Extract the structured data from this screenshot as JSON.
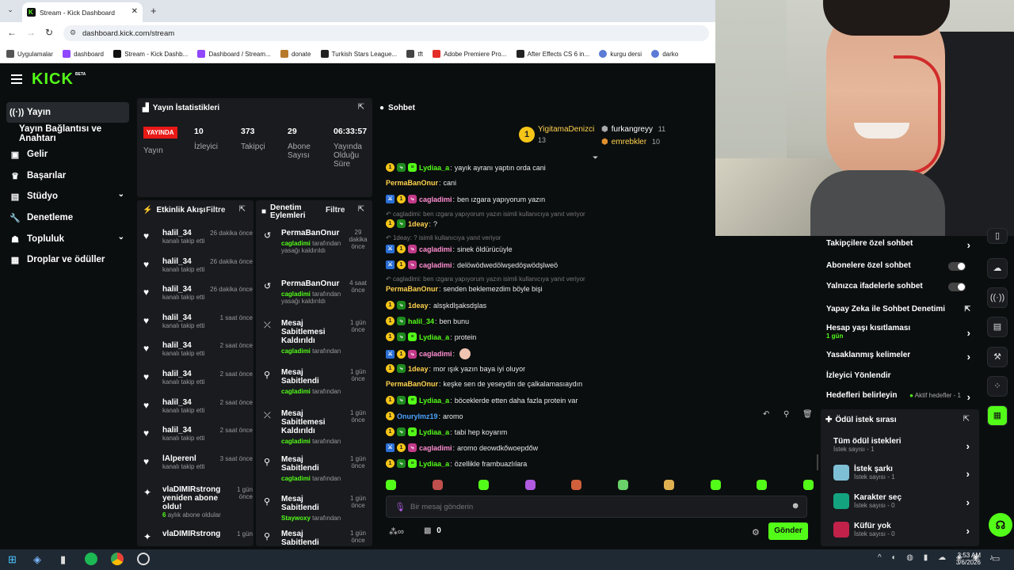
{
  "browser": {
    "tab_title": "Stream - Kick Dashboard",
    "url": "dashboard.kick.com/stream",
    "bookmarks": [
      "Uygulamalar",
      "dashboard",
      "Stream - Kick Dashb...",
      "Dashboard / Stream...",
      "donate",
      "Turkish Stars League...",
      "tft",
      "Adobe Premiere Pro...",
      "After Effects CS 6 in...",
      "kurgu dersi",
      "darko"
    ]
  },
  "header": {
    "logo": "KICK",
    "beta": "BETA"
  },
  "sidebar": {
    "items": [
      {
        "label": "Yayın",
        "icon": "broadcast-icon"
      },
      {
        "label": "Yayın Bağlantısı ve Anahtarı",
        "icon": ""
      },
      {
        "label": "Gelir",
        "icon": "money-icon"
      },
      {
        "label": "Başarılar",
        "icon": "trophy-icon"
      },
      {
        "label": "Stüdyo",
        "icon": "studio-icon"
      },
      {
        "label": "Denetleme",
        "icon": "wrench-icon"
      },
      {
        "label": "Topluluk",
        "icon": "people-icon"
      },
      {
        "label": "Droplar ve ödüller",
        "icon": "gift-icon"
      }
    ]
  },
  "stats": {
    "title": "Yayın İstatistikleri",
    "live_badge": "YAYINDA",
    "live_label": "Yayın",
    "viewers": "10",
    "viewers_label": "İzleyici",
    "followers": "373",
    "followers_label": "Takipçi",
    "subs": "29",
    "subs_label": "Abone Sayısı",
    "uptime": "06:33:57",
    "uptime_label": "Yayında Olduğu Süre"
  },
  "activity": {
    "title": "Etkinlik Akışı",
    "filter": "Filtre",
    "items": [
      {
        "user": "halil_34",
        "sub": "kanalı takip etti",
        "time": "26 dakika önce"
      },
      {
        "user": "halil_34",
        "sub": "kanalı takip etti",
        "time": "26 dakika önce"
      },
      {
        "user": "halil_34",
        "sub": "kanalı takip etti",
        "time": "26 dakika önce"
      },
      {
        "user": "halil_34",
        "sub": "kanalı takip etti",
        "time": "1 saat önce"
      },
      {
        "user": "halil_34",
        "sub": "kanalı takip etti",
        "time": "2 saat önce"
      },
      {
        "user": "halil_34",
        "sub": "kanalı takip etti",
        "time": "2 saat önce"
      },
      {
        "user": "halil_34",
        "sub": "kanalı takip etti",
        "time": "2 saat önce"
      },
      {
        "user": "halil_34",
        "sub": "kanalı takip etti",
        "time": "2 saat önce"
      },
      {
        "user": "lAlperenl",
        "sub": "kanalı takip etti",
        "time": "3 saat önce"
      }
    ],
    "resub": {
      "user": "vlaDIMIRstrong yeniden abone oldu!",
      "months": "6",
      "sub": "aylık abone oldular",
      "time": "1 gün önce"
    },
    "last": {
      "user": "vlaDIMIRstrong",
      "time": "1 gün"
    }
  },
  "moderation": {
    "title": "Denetim Eylemleri",
    "filter": "Filtre",
    "items": [
      {
        "title": "PermaBanOnur",
        "mod": "cagladimi",
        "sub": "tarafından yasağı kaldırıldı",
        "time": "29 dakika önce"
      },
      {
        "title": "PermaBanOnur",
        "mod": "cagladimi",
        "sub": "tarafından yasağı kaldırıldı",
        "time": "4 saat önce"
      },
      {
        "title": "Mesaj Sabitlemesi Kaldırıldı",
        "mod": "cagladimi",
        "sub": "tarafından",
        "time": "1 gün önce"
      },
      {
        "title": "Mesaj Sabitlendi",
        "mod": "cagladimi",
        "sub": "tarafından",
        "time": "1 gün önce"
      },
      {
        "title": "Mesaj Sabitlemesi Kaldırıldı",
        "mod": "cagladimi",
        "sub": "tarafından",
        "time": "1 gün önce"
      },
      {
        "title": "Mesaj Sabitlendi",
        "mod": "cagladimi",
        "sub": "tarafından",
        "time": "1 gün önce"
      },
      {
        "title": "Mesaj Sabitlendi",
        "mod": "Staywoxy",
        "sub": "tarafından",
        "time": "1 gün önce"
      },
      {
        "title": "Mesaj Sabitlendi",
        "mod": "",
        "sub": "",
        "time": "1 gün önce"
      }
    ]
  },
  "chat": {
    "title": "Sohbet",
    "top_gifters": [
      {
        "name": "YigitamaDenizci",
        "count": "13"
      },
      {
        "name": "furkangreyy",
        "count": "11"
      },
      {
        "name": "emrebkler",
        "count": "10"
      }
    ],
    "messages": [
      {
        "user": "Lydiaa_a",
        "text": "yayık ayranı yaptın orda cani",
        "color": "#53fc18"
      },
      {
        "user": "PermaBanOnur",
        "text": "cani",
        "color": "#ffd24d"
      },
      {
        "user": "cagladimi",
        "text": "ben ızgara yapıyorum yazın",
        "color": "#ff8fd2"
      },
      {
        "reply": "cagladimi: ben ızgara yapıyorum yazın isimli kullanıcıya yanıt veriyor"
      },
      {
        "user": "1deay",
        "text": "?",
        "color": "#ffd24d"
      },
      {
        "reply": "1deay: ? isimli kullanıcıya yanıt veriyor"
      },
      {
        "user": "cagladimi",
        "text": "sinek öldürücüyle",
        "color": "#ff8fd2"
      },
      {
        "user": "cagladimi",
        "text": "delöwödwedölwşedöşwödşlweö",
        "color": "#ff8fd2"
      },
      {
        "reply": "cagladimi: ben ızgara yapıyorum yazın isimli kullanıcıya yanıt veriyor"
      },
      {
        "user": "PermaBanOnur",
        "text": "senden beklemezdim böyle bişi",
        "color": "#ffd24d"
      },
      {
        "user": "1deay",
        "text": "alsşkdlşaksdşlas",
        "color": "#ffd24d"
      },
      {
        "user": "halil_34",
        "text": "ben bunu",
        "color": "#53fc18"
      },
      {
        "user": "Lydiaa_a",
        "text": "protein",
        "color": "#53fc18"
      },
      {
        "user": "cagladimi",
        "text": "",
        "color": "#ff8fd2"
      },
      {
        "user": "1deay",
        "text": "mor ışık yazın baya iyi oluyor",
        "color": "#ffd24d"
      },
      {
        "user": "PermaBanOnur",
        "text": "keşke sen de yeseydin de çalkalamasıaydın",
        "color": "#ffd24d"
      },
      {
        "user": "Lydiaa_a",
        "text": "böceklerde etten daha fazla protein var",
        "color": "#53fc18"
      },
      {
        "user": "Onurylmz19",
        "text": "aromo",
        "color": "#4aa3ff"
      },
      {
        "user": "Lydiaa_a",
        "text": "tabi hep koyarım",
        "color": "#53fc18"
      },
      {
        "user": "cagladimi",
        "text": "aromo deowdkőwoepdőw",
        "color": "#ff8fd2"
      },
      {
        "user": "Lydiaa_a",
        "text": "özellikle frambuazlılara",
        "color": "#53fc18"
      }
    ],
    "input_placeholder": "Bir mesaj gönderin",
    "send": "Gönder",
    "gift_count": "0"
  },
  "chat_settings": {
    "items": [
      {
        "label": "Takipçilere özel sohbet",
        "type": "chevron"
      },
      {
        "label": "Abonelere özel sohbet",
        "type": "toggle"
      },
      {
        "label": "Yalnızca ifadelerle sohbet",
        "type": "toggle"
      },
      {
        "label": "Yapay Zeka ile Sohbet Denetimi",
        "type": "external"
      },
      {
        "label": "Hesap yaşı kısıtlaması",
        "sub": "1 gün",
        "type": "chevron"
      },
      {
        "label": "Yasaklanmış kelimeler",
        "type": "chevron"
      },
      {
        "label": "İzleyici Yönlendir",
        "type": "none"
      },
      {
        "label": "Hedefleri belirleyin",
        "extra": "Aktif hedefler - 1",
        "type": "chevron"
      }
    ]
  },
  "rewards": {
    "title": "Ödül istek sırası",
    "items": [
      {
        "label": "Tüm ödül istekleri",
        "sub": "İstek sayısı - 1"
      },
      {
        "label": "İstek şarkı",
        "sub": "İstek sayısı - 1"
      },
      {
        "label": "Karakter seç",
        "sub": "İstek sayısı - 0"
      },
      {
        "label": "Küfür yok",
        "sub": "İstek sayısı - 0"
      }
    ]
  },
  "taskbar": {
    "time": "3:53 AM",
    "date": "3/6/2026"
  },
  "colors": {
    "accent": "#53fc18",
    "panel": "#191b1f",
    "background": "#0b0e0f"
  }
}
